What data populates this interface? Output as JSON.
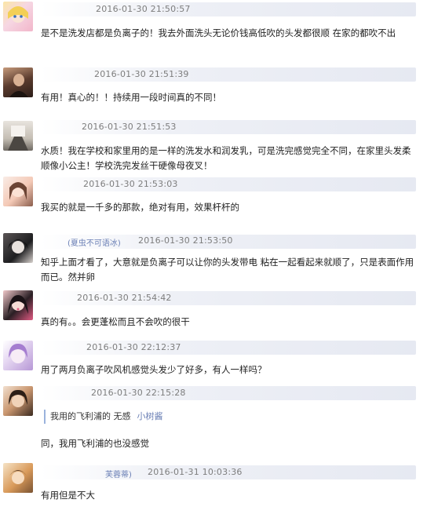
{
  "comments": [
    {
      "username": "",
      "timestamp": "2016-01-30 21:50:57",
      "text": "是不是洗发店都是负离子的！我去外面洗头无论价钱高低吹的头发都很顺 在家的都吹不出",
      "avatar_colors": [
        "#f6d7e3",
        "#f2b6ca",
        "#fbe6a6"
      ]
    },
    {
      "username": "",
      "timestamp": "2016-01-30 21:51:39",
      "text": "有用！真心的！！持续用一段时间真的不同！",
      "avatar_colors": [
        "#5a3b2e",
        "#2b1d18",
        "#c69a7b"
      ]
    },
    {
      "username": "",
      "timestamp": "2016-01-30 21:51:53",
      "text": "水质！我在学校和家里用的是一样的洗发水和润发乳，可是洗完感觉完全不同，在家里头发柔顺像小公主！学校洗完发丝干硬像母夜叉！",
      "avatar_colors": [
        "#e8e4de",
        "#c4bdb3",
        "#6f6a63"
      ]
    },
    {
      "username": "",
      "timestamp": "2016-01-30 21:53:03",
      "text": "我买的就是一千多的那款，绝对有用，效果杆杆的",
      "avatar_colors": [
        "#f4c9b6",
        "#8a5d4c",
        "#f9ece6"
      ]
    },
    {
      "username": "(夏虫不可语冰)",
      "timestamp": "2016-01-30 21:53:50",
      "text": "知乎上面才看了，大意就是负离子可以让你的头发带电 粘在一起看起来就顺了，只是表面作用而已。然并卵",
      "avatar_colors": [
        "#1d1d1f",
        "#5a5556",
        "#d9d3cf"
      ]
    },
    {
      "username": "",
      "timestamp": "2016-01-30 21:54:42",
      "text": "真的有。。会更蓬松而且不会吹的很干",
      "avatar_colors": [
        "#2a1f24",
        "#e05a82",
        "#f0c7c9"
      ]
    },
    {
      "username": "",
      "timestamp": "2016-01-30 22:12:37",
      "text": "用了两月负离子吹风机感觉头发少了好多，有人一样吗？",
      "avatar_colors": [
        "#b798d6",
        "#e6d8f2",
        "#ffffff"
      ]
    },
    {
      "username": "",
      "timestamp": "2016-01-30 22:15:28",
      "quote": "我用的飞利浦的 无感",
      "quote_user": "小树酱",
      "text": "同，我用飞利浦的也没感觉",
      "avatar_colors": [
        "#3b2a20",
        "#c9966f",
        "#f2e0cf"
      ]
    },
    {
      "username": "芙蓉蒂)",
      "timestamp": "2016-01-31 10:03:36",
      "text": "有用但是不大",
      "avatar_colors": [
        "#d99a5a",
        "#f6e3c6",
        "#7a5332"
      ]
    }
  ]
}
